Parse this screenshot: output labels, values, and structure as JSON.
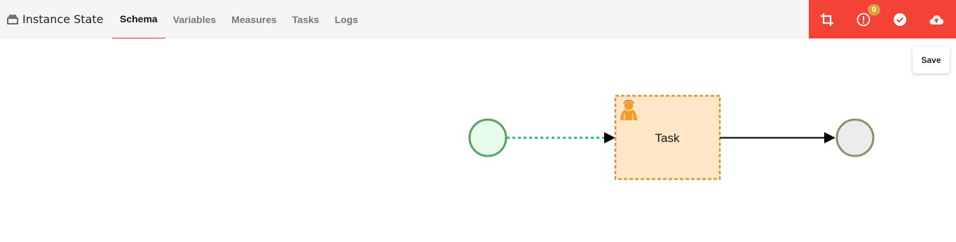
{
  "header": {
    "title": "Instance State",
    "icon": "window-stack-icon"
  },
  "tabs": [
    {
      "label": "Schema",
      "active": true
    },
    {
      "label": "Variables",
      "active": false
    },
    {
      "label": "Measures",
      "active": false
    },
    {
      "label": "Tasks",
      "active": false
    },
    {
      "label": "Logs",
      "active": false
    }
  ],
  "toolbar": {
    "background": "#f44336",
    "buttons": [
      {
        "icon": "crop-icon"
      },
      {
        "icon": "alert-circle-icon",
        "badge": "0"
      },
      {
        "icon": "check-circle-icon"
      },
      {
        "icon": "cloud-upload-icon"
      }
    ],
    "save_tooltip": "Save"
  },
  "diagram": {
    "task_label": "Task",
    "task_icon": "user-task-icon",
    "start_event_color": "#e6fbe9",
    "end_event_color": "#ececec",
    "task_fill": "#ffe6c7",
    "task_border": "#d4953a"
  }
}
